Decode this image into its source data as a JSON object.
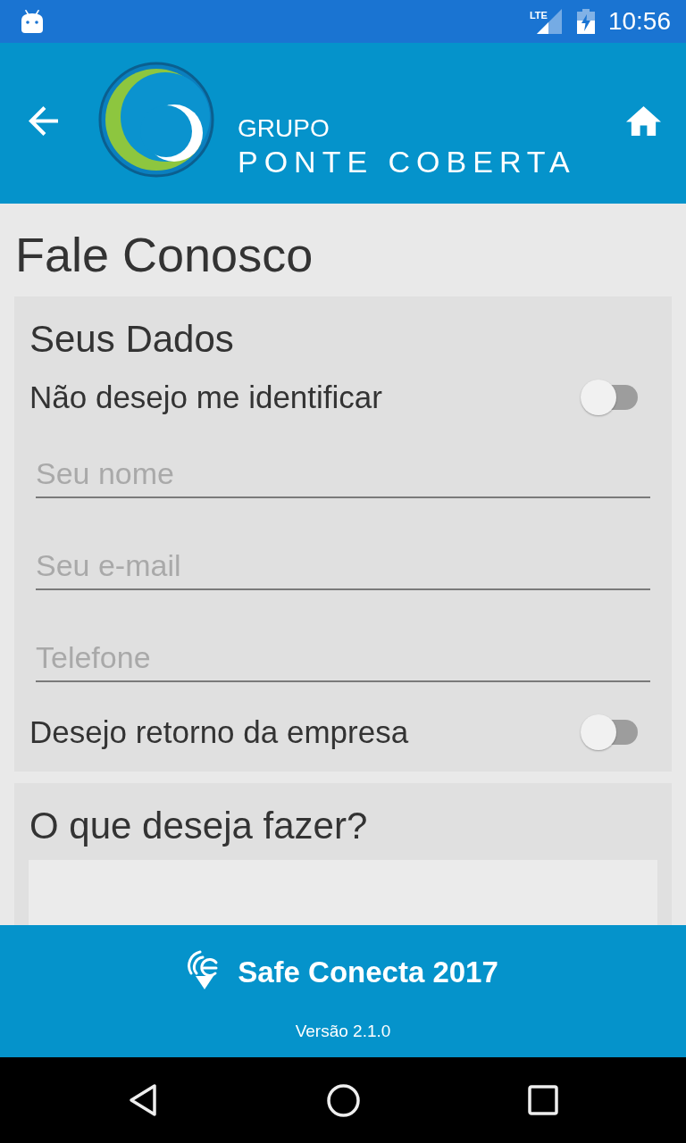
{
  "status_bar": {
    "network": "LTE",
    "time": "10:56"
  },
  "app_bar": {
    "logo_line_1": "GRUPO",
    "logo_line_2": "PONTE COBERTA"
  },
  "page_title": "Fale Conosco",
  "sections": [
    {
      "title": "Seus Dados",
      "items": [
        {
          "kind": "switch",
          "label": "Não desejo me identificar",
          "on": false
        },
        {
          "kind": "field",
          "placeholder": "Seu nome"
        },
        {
          "kind": "field",
          "placeholder": "Seu e-mail"
        },
        {
          "kind": "field",
          "placeholder": "Telefone"
        },
        {
          "kind": "switch",
          "label": "Desejo retorno da empresa",
          "on": false
        }
      ]
    },
    {
      "title": "O que deseja fazer?",
      "items": [
        {
          "kind": "textarea"
        }
      ]
    }
  ],
  "footer": {
    "app_name": "Safe Conecta 2017",
    "version": "Versão 2.1.0"
  }
}
